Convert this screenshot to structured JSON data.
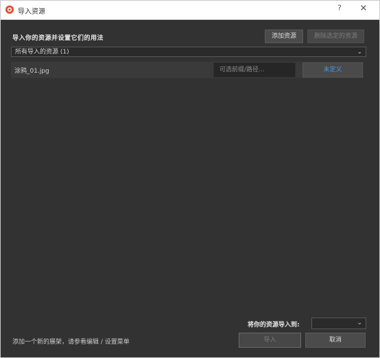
{
  "window": {
    "title": "导入资源",
    "help_label": "?",
    "close_label": "✕"
  },
  "content": {
    "heading": "导入你的资源并设置它们的用法",
    "add_resource_label": "添加资源",
    "remove_selected_label": "删除选定的资源",
    "filter": {
      "selected": "所有导入的资源 (1)"
    },
    "assets": [
      {
        "name": "涂鸦_01.jpg",
        "prefix_placeholder": "可选前缀/路径...",
        "usage": "未定义"
      }
    ],
    "import_to_label": "将你的资源导入到:",
    "import_to": {
      "selected": ""
    },
    "footer_note": "添加一个新的展架，请参看编辑 / 设置菜单",
    "import_button": "导入",
    "cancel_button": "取消"
  },
  "colors": {
    "background": "#323232",
    "titlebar": "#ffffff",
    "accent_link": "#4f96e8",
    "button": "#4b4b4b"
  },
  "icons": [
    "app-logo-icon",
    "help-icon",
    "close-icon",
    "chevron-down-icon"
  ]
}
